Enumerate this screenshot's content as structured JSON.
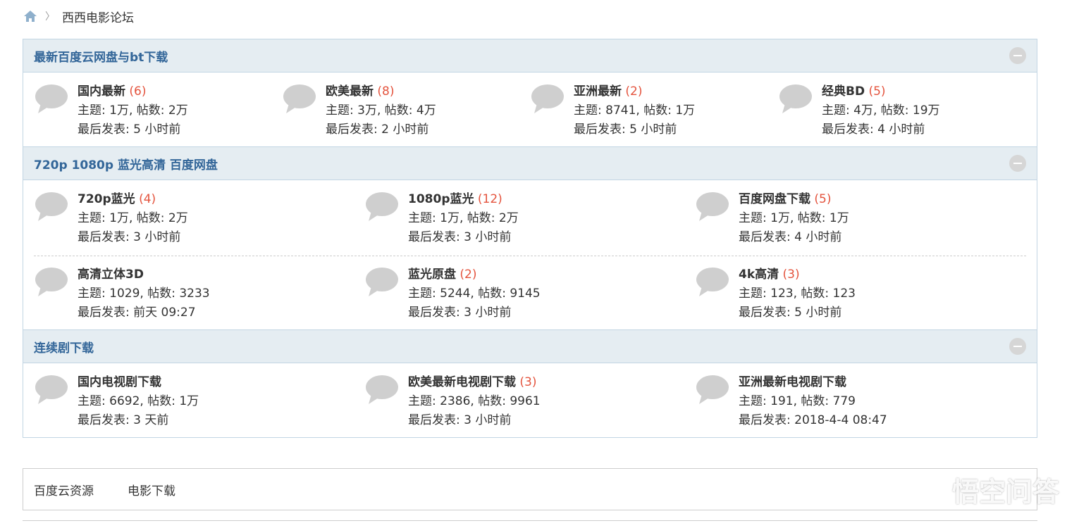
{
  "breadcrumb": {
    "home_icon": "home-icon",
    "separator": "〉",
    "current": "西西电影论坛"
  },
  "categories": [
    {
      "title": "最新百度云网盘与bt下载",
      "rows": [
        [
          {
            "name": "国内最新",
            "count": "(6)",
            "stats": "主题: 1万, 帖数: 2万",
            "last": "最后发表: 5 小时前"
          },
          {
            "name": "欧美最新",
            "count": "(8)",
            "stats": "主题: 3万, 帖数: 4万",
            "last": "最后发表: 2 小时前"
          },
          {
            "name": "亚洲最新",
            "count": "(2)",
            "stats": "主题: 8741, 帖数: 1万",
            "last": "最后发表: 5 小时前"
          },
          {
            "name": "经典BD",
            "count": "(5)",
            "stats": "主题: 4万, 帖数: 19万",
            "last": "最后发表: 4 小时前"
          }
        ]
      ]
    },
    {
      "title": "720p 1080p 蓝光高清 百度网盘",
      "rows": [
        [
          {
            "name": "720p蓝光",
            "count": "(4)",
            "stats": "主题: 1万, 帖数: 2万",
            "last": "最后发表: 3 小时前"
          },
          {
            "name": "1080p蓝光",
            "count": "(12)",
            "stats": "主题: 1万, 帖数: 2万",
            "last": "最后发表: 3 小时前"
          },
          {
            "name": "百度网盘下载",
            "count": "(5)",
            "stats": "主题: 1万, 帖数: 1万",
            "last": "最后发表: 4 小时前"
          }
        ],
        [
          {
            "name": "高清立体3D",
            "count": "",
            "stats": "主题: 1029, 帖数: 3233",
            "last": "最后发表: 前天 09:27"
          },
          {
            "name": "蓝光原盘",
            "count": "(2)",
            "stats": "主题: 5244, 帖数: 9145",
            "last": "最后发表: 3 小时前"
          },
          {
            "name": "4k高清",
            "count": "(3)",
            "stats": "主题: 123, 帖数: 123",
            "last": "最后发表: 5 小时前"
          }
        ]
      ]
    },
    {
      "title": "连续剧下载",
      "rows": [
        [
          {
            "name": "国内电视剧下载",
            "count": "",
            "stats": "主题: 6692, 帖数: 1万",
            "last": "最后发表: 3 天前"
          },
          {
            "name": "欧美最新电视剧下载",
            "count": "(3)",
            "stats": "主题: 2386, 帖数: 9961",
            "last": "最后发表: 3 小时前"
          },
          {
            "name": "亚洲最新电视剧下载",
            "count": "",
            "stats": "主题: 191, 帖数: 779",
            "last": "最后发表: 2018-4-4 08:47"
          }
        ]
      ]
    }
  ],
  "links": [
    "百度云资源",
    "电影下载"
  ],
  "watermark": {
    "text": "悟空问答",
    "icon": "wukong-logo-icon"
  },
  "colors": {
    "category_title": "#336699",
    "category_bg": "#e5edf2",
    "border": "#c2d5e3",
    "count": "#e4543e"
  }
}
